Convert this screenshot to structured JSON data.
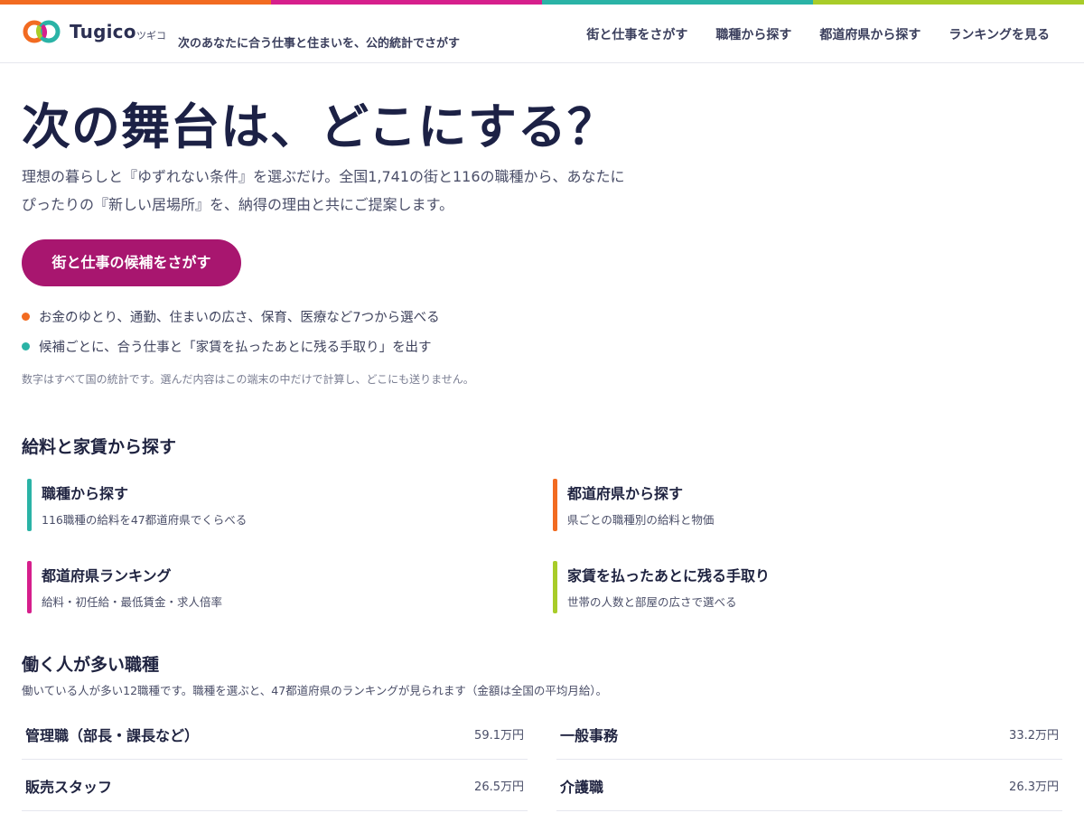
{
  "colors": {
    "stripe": [
      "#f26b21",
      "#d61f8c",
      "#2ab3a6",
      "#a8cc29"
    ],
    "accent": "#a8166f",
    "bullet_dots": [
      "#f26b21",
      "#2ab3a6"
    ],
    "card_bars": [
      "#2ab3a6",
      "#f26b21",
      "#d61f8c",
      "#a8cc29"
    ]
  },
  "header": {
    "brand": "Tugico",
    "brand_kana": "ツギコ",
    "tagline": "次のあなたに合う仕事と住まいを、公的統計でさがす",
    "nav": [
      "街と仕事をさがす",
      "職種から探す",
      "都道府県から探す",
      "ランキングを見る"
    ]
  },
  "hero": {
    "title": "次の舞台は、どこにする？",
    "lead_line1": "理想の暮らしと『ゆずれない条件』を選ぶだけ。全国1,741の街と116の職種から、あなたに",
    "lead_line2": "ぴったりの『新しい居場所』を、納得の理由と共にご提案します。",
    "cta": "街と仕事の候補をさがす",
    "bullets": [
      "お金のゆとり、通勤、住まいの広さ、保育、医療など7つから選べる",
      "候補ごとに、合う仕事と「家賃を払ったあとに残る手取り」を出す"
    ],
    "note": "数字はすべて国の統計です。選んだ内容はこの端末の中だけで計算し、どこにも送りません。"
  },
  "search_section": {
    "title": "給料と家賃から探す",
    "cards": [
      {
        "title": "職種から探す",
        "sub": "116職種の給料を47都道府県でくらべる"
      },
      {
        "title": "都道府県から探す",
        "sub": "県ごとの職種別の給料と物価"
      },
      {
        "title": "都道府県ランキング",
        "sub": "給料・初任給・最低賃金・求人倍率"
      },
      {
        "title": "家賃を払ったあとに残る手取り",
        "sub": "世帯の人数と部屋の広さで選べる"
      }
    ]
  },
  "jobs_section": {
    "title": "働く人が多い職種",
    "sub": "働いている人が多い12職種です。職種を選ぶと、47都道府県のランキングが見られます（金額は全国の平均月給）。",
    "jobs": [
      {
        "name": "管理職（部長・課長など）",
        "value": "59.1万円"
      },
      {
        "name": "一般事務",
        "value": "33.2万円"
      },
      {
        "name": "販売スタッフ",
        "value": "26.5万円"
      },
      {
        "name": "介護職",
        "value": "26.3万円"
      }
    ]
  }
}
